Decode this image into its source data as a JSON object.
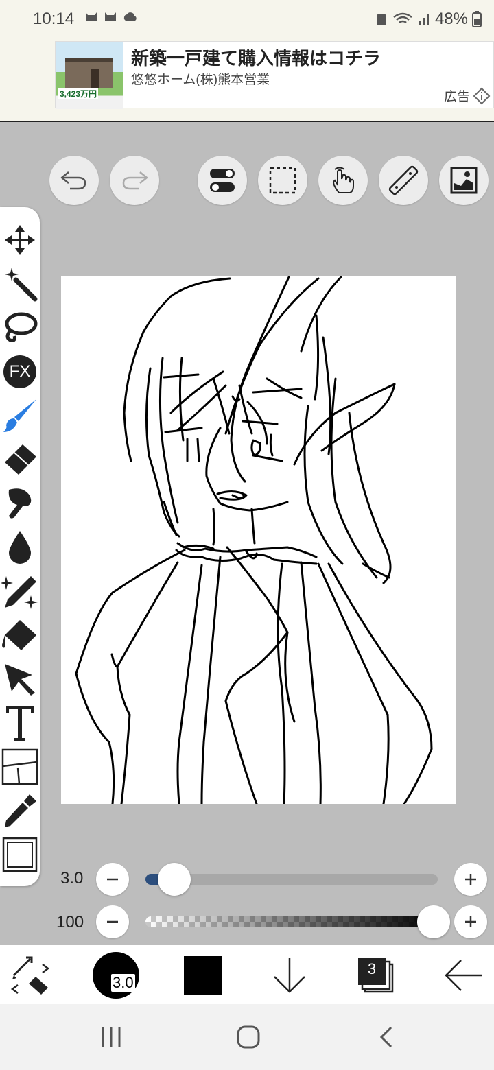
{
  "status": {
    "time": "10:14",
    "battery": "48%"
  },
  "ad": {
    "title": "新築一戸建て購入情報はコチラ",
    "subtitle": "悠悠ホーム(株)熊本営業",
    "label": "広告",
    "price": "3,423万円"
  },
  "toolbar": {
    "buttons": [
      "undo",
      "redo",
      "toggle-settings",
      "selection",
      "touch",
      "ruler",
      "image"
    ]
  },
  "tools": [
    "move",
    "magic-wand",
    "lasso",
    "fx",
    "brush",
    "eraser",
    "smudge",
    "blur",
    "special-brush",
    "fill",
    "select-pointer",
    "text",
    "frame-divider",
    "eyedropper",
    "canvas"
  ],
  "fx_label": "FX",
  "sliders": {
    "size": {
      "value": "3.0",
      "level": 0.07
    },
    "opacity": {
      "value": "100",
      "level": 1.0
    }
  },
  "bottom": {
    "brush_size": "3.0",
    "color": "#000000",
    "layer_count": "3"
  }
}
